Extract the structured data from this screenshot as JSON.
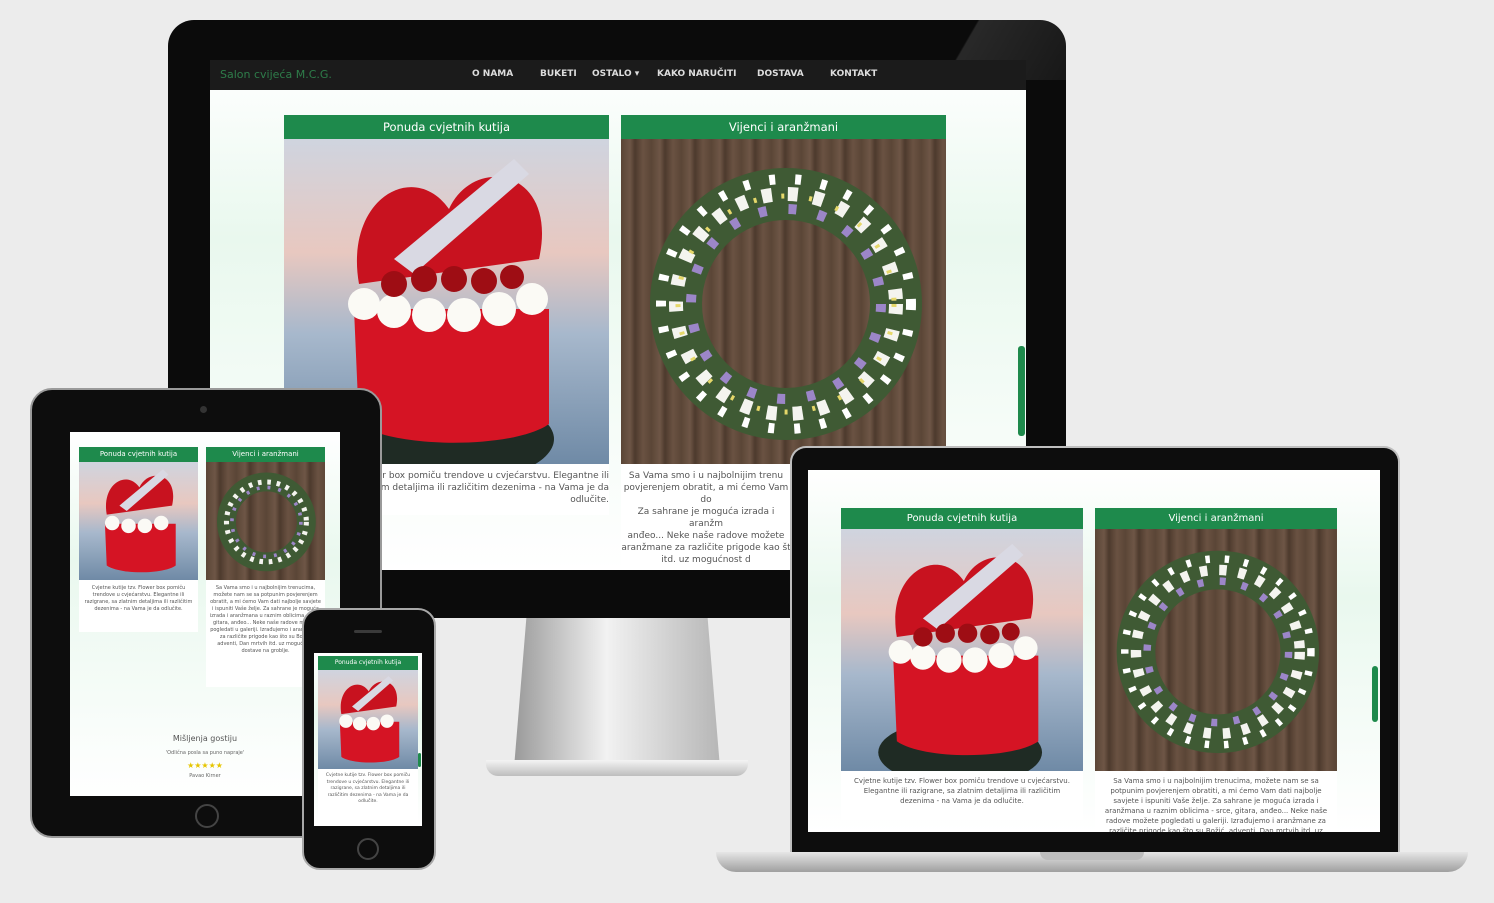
{
  "site": {
    "brand": "Salon cvijeća M.C.G.",
    "nav": [
      "O NAMA",
      "BUKETI",
      "OSTALO ▾",
      "KAKO NARUČITI",
      "DOSTAVA",
      "KONTAKT"
    ]
  },
  "cards": {
    "boxes_title": "Ponuda cvjetnih kutija",
    "wreath_title": "Vijenci i aranžmani",
    "boxes_text": "Cvjetne kutije tzv. Flower box pomiču trendove u cvjećarstvu. Elegantne ili razigrane, sa zlatnim detaljima ili različitim dezenima - na Vama je da odlučite.",
    "wreath_text": "Sa Vama smo i u najbolnijim trenucima, možete nam se sa potpunim povjerenjem obratiti, a mi ćemo Vam dati najbolje savjete i ispuniti Vaše želje. Za sahrane je moguća izrada i aranžmana u raznim oblicima - srce, gitara, anđeo... Neke naše radove možete pogledati u galeriji. Izrađujemo i aranžmane za različite prigode kao što su Božić, adventi, Dan mrtvih itd. uz mogućnost dostave na grobije."
  },
  "monitor": {
    "boxes_text_visible": "wer box pomiču trendove u cvjećarstvu. Elegantne ili\nm detaljima ili različitim dezenima - na Vama je da\nodlučite.",
    "wreath_text_visible": "Sa Vama smo i u najbolnijim trenu\npovjerenjem obratit, a mi ćemo Vam do\nZa sahrane je moguća izrada i aranžm\nanđeo... Neke naše radove možete\naranžmane za različite prigode kao št\nitd. uz mogućnost d"
  },
  "tablet": {
    "boxes_text": "Cvjetne kutije tzv. Flower box pomiču trendove u cvjećarstvu. Elegantne ili razigrane, sa zlatnim detaljima ili različitim dezenima - na Vama je da odlučite.",
    "wreath_text": "Sa Vama smo i u najbolnijim trenucima, možete nam se sa potpunim povjerenjem obratit, a mi ćemo Vam dati najbolje savjete i ispuniti Vaše želje. Za sahrane je moguća izrada i aranžmana u raznim oblicima - srce, gitara, anđeo... Neke naše radove možete pogledati u galeriji. Izrađujemo i aranžmane za različite prigode kao što su Božić, adventi, Dan mrtvih itd. uz mogućnost dostave na groblje.",
    "testimonials_title": "Mišljenja gostiju",
    "quote": "'Odlična posla sa puno napraje'",
    "stars": "★★★★★",
    "author": "Pavao Kirner"
  },
  "phone": {
    "card_title": "Ponuda cvjetnih kutija",
    "card_text": "Cvjetne kutije tzv. Flower box pomiču trendove u cvjećarstvu. Elegantne ili razigrane, sa zlatnim detaljima ili različitim dezenima - na Vama je da odlučite."
  },
  "colors": {
    "accent": "#1e8a4c",
    "brand_text": "#2e7d4a",
    "navbar": "#1b1b1b"
  }
}
